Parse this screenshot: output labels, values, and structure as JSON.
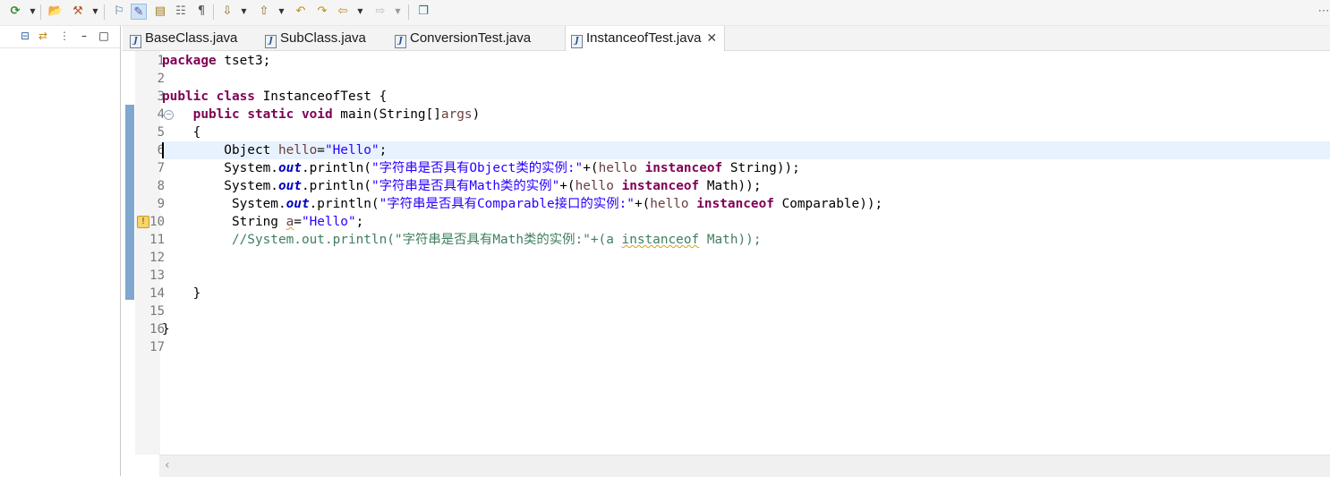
{
  "toolbar": {
    "icons": [
      "run-icon",
      "open-folder-icon",
      "build-icon",
      "toggle-highlight-icon",
      "pen-icon",
      "save-icon",
      "document-icon",
      "paragraph-icon",
      "next-annotation-icon",
      "previous-annotation-icon",
      "back-icon",
      "forward-icon",
      "last-edit-icon",
      "next-edit-icon",
      "new-window-icon"
    ]
  },
  "tabs": [
    {
      "label": "BaseClass.java",
      "active": false
    },
    {
      "label": "SubClass.java",
      "active": false
    },
    {
      "label": "ConversionTest.java",
      "active": false
    },
    {
      "label": "InstanceofTest.java",
      "active": true
    }
  ],
  "editor": {
    "current_line": 6,
    "line_numbers": [
      "1",
      "2",
      "3",
      "4",
      "5",
      "6",
      "7",
      "8",
      "9",
      "10",
      "11",
      "12",
      "13",
      "14",
      "15",
      "16",
      "17"
    ],
    "lines": [
      [
        {
          "t": "package",
          "c": "kw"
        },
        {
          "t": " tset3;"
        }
      ],
      [],
      [
        {
          "t": "public",
          "c": "kw"
        },
        {
          "t": " "
        },
        {
          "t": "class",
          "c": "kw"
        },
        {
          "t": " InstanceofTest {"
        }
      ],
      [
        {
          "t": "    "
        },
        {
          "t": "public",
          "c": "kw"
        },
        {
          "t": " "
        },
        {
          "t": "static",
          "c": "kw"
        },
        {
          "t": " "
        },
        {
          "t": "void",
          "c": "kw"
        },
        {
          "t": " main(String[]"
        },
        {
          "t": "args",
          "c": "var"
        },
        {
          "t": ")"
        }
      ],
      [
        {
          "t": "    {"
        }
      ],
      [
        {
          "t": "        Object "
        },
        {
          "t": "hello",
          "c": "var"
        },
        {
          "t": "="
        },
        {
          "t": "\"Hello\"",
          "c": "str"
        },
        {
          "t": ";"
        }
      ],
      [
        {
          "t": "        System."
        },
        {
          "t": "out",
          "c": "fld"
        },
        {
          "t": ".println("
        },
        {
          "t": "\"字符串是否具有Object类的实例:\"",
          "c": "str"
        },
        {
          "t": "+("
        },
        {
          "t": "hello",
          "c": "var"
        },
        {
          "t": " "
        },
        {
          "t": "instanceof",
          "c": "kw"
        },
        {
          "t": " String));"
        }
      ],
      [
        {
          "t": "        System."
        },
        {
          "t": "out",
          "c": "fld"
        },
        {
          "t": ".println("
        },
        {
          "t": "\"字符串是否具有Math类的实例\"",
          "c": "str"
        },
        {
          "t": "+("
        },
        {
          "t": "hello",
          "c": "var"
        },
        {
          "t": " "
        },
        {
          "t": "instanceof",
          "c": "kw"
        },
        {
          "t": " Math));"
        }
      ],
      [
        {
          "t": "         System."
        },
        {
          "t": "out",
          "c": "fld"
        },
        {
          "t": ".println("
        },
        {
          "t": "\"字符串是否具有Comparable接口的实例:\"",
          "c": "str"
        },
        {
          "t": "+("
        },
        {
          "t": "hello",
          "c": "var"
        },
        {
          "t": " "
        },
        {
          "t": "instanceof",
          "c": "kw"
        },
        {
          "t": " Comparable));"
        }
      ],
      [
        {
          "t": "         String "
        },
        {
          "t": "a",
          "c": "var squig"
        },
        {
          "t": "="
        },
        {
          "t": "\"Hello\"",
          "c": "str"
        },
        {
          "t": ";"
        }
      ],
      [
        {
          "t": "         "
        },
        {
          "t": "//System.out.println(\"字符串是否具有Math类的实例:\"+(a ",
          "c": "cmt"
        },
        {
          "t": "instanceof",
          "c": "cmt squig"
        },
        {
          "t": " Math));",
          "c": "cmt"
        }
      ],
      [],
      [],
      [
        {
          "t": "    }"
        }
      ],
      [],
      [
        {
          "t": "}"
        }
      ],
      []
    ]
  }
}
